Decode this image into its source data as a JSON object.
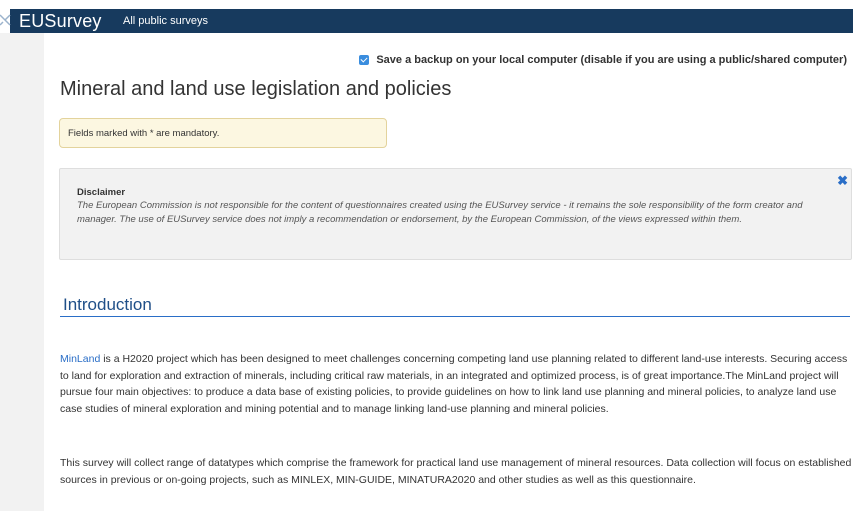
{
  "header": {
    "logo_text": "EUSurvey",
    "nav_link": "All public surveys",
    "bg_color": "#173a5e"
  },
  "backup": {
    "checked": true,
    "label": "Save a backup on your local computer (disable if you are using a public/shared computer)"
  },
  "survey": {
    "title": "Mineral and land use legislation and policies",
    "mandatory_note": "Fields marked with * are mandatory."
  },
  "disclaimer": {
    "title": "Disclaimer",
    "text": "The European Commission is not responsible for the content of questionnaires created using the EUSurvey service - it remains the sole responsibility of the form creator and manager. The use of EUSurvey service does not imply a recommendation or endorsement, by the European Commission, of the views expressed within them.",
    "close_icon": "close-icon"
  },
  "section": {
    "title": "Introduction"
  },
  "intro": {
    "link_text": "MinLand",
    "para1_rest": " is a H2020 project which has been designed to meet challenges concerning competing land use planning related to different land-use interests. Securing access to land for exploration and extraction of minerals, including critical raw materials, in an integrated and optimized process, is of great importance.The MinLand project will pursue four main objectives: to produce a data base of existing policies, to provide guidelines on how to link land use planning and mineral policies, to analyze land use case studies of mineral exploration and mining potential and to manage linking land-use planning and mineral policies.",
    "para2": "This survey will collect range of datatypes which comprise the framework for practical land use management of mineral resources. Data collection will focus on established sources in previous or on-going projects, such as MINLEX, MIN-GUIDE, MINATURA2020 and other studies as well as this questionnaire."
  }
}
